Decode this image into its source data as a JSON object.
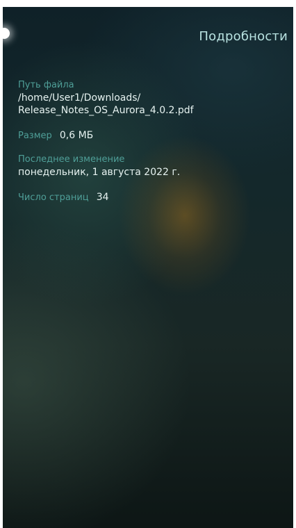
{
  "header": {
    "title": "Подробности"
  },
  "details": {
    "file_path": {
      "label": "Путь файла",
      "line1": "/home/User1/Downloads/",
      "line2": "Release_Notes_OS_Aurora_4.0.2.pdf"
    },
    "size": {
      "label": "Размер",
      "value": "0,6 МБ"
    },
    "modified": {
      "label": "Последнее изменение",
      "value": "понедельник, 1 августа 2022 г."
    },
    "pages": {
      "label": "Число страниц",
      "value": "34"
    }
  },
  "colors": {
    "label": "#4f9f98",
    "value": "#e7f3f1",
    "title": "#b8e2e0"
  }
}
